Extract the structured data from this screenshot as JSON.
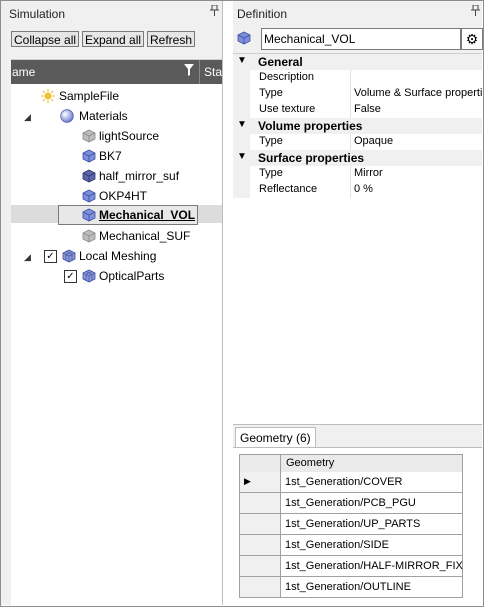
{
  "simulation_panel": {
    "title": "Simulation",
    "pin_glyph": "↑",
    "toolbar": {
      "collapse_all": "Collapse all",
      "expand_all": "Expand all",
      "refresh": "Refresh"
    },
    "tree_header": {
      "name_col": "ame",
      "status_col": "Sta"
    },
    "tree": [
      {
        "label": "SampleFile",
        "icon": "sun-icon"
      },
      {
        "label": "Materials",
        "icon": "sphere-icon",
        "expanded": true
      },
      {
        "label": "lightSource",
        "icon": "cube-gray-icon"
      },
      {
        "label": "BK7",
        "icon": "cube-blue-icon"
      },
      {
        "label": "half_mirror_suf",
        "icon": "cube-dark-icon"
      },
      {
        "label": "OKP4HT",
        "icon": "cube-blue-icon"
      },
      {
        "label": "Mechanical_VOL",
        "icon": "cube-blue-icon",
        "selected": true
      },
      {
        "label": "Mechanical_SUF",
        "icon": "cube-gray-icon"
      },
      {
        "label": "Local Meshing",
        "icon": "mesh-icon",
        "checked": true,
        "expanded": true
      },
      {
        "label": "OpticalParts",
        "icon": "mesh-icon",
        "checked": true
      }
    ]
  },
  "definition_panel": {
    "title": "Definition",
    "pin_glyph": "↑",
    "name_value": "Mechanical_VOL",
    "categories": [
      {
        "label": "General",
        "rows": [
          {
            "name": "Description",
            "value": ""
          },
          {
            "name": "Type",
            "value": "Volume & Surface properties"
          },
          {
            "name": "Use texture",
            "value": "False"
          }
        ]
      },
      {
        "label": "Volume properties",
        "rows": [
          {
            "name": "Type",
            "value": "Opaque"
          }
        ]
      },
      {
        "label": "Surface properties",
        "rows": [
          {
            "name": "Type",
            "value": "Mirror"
          },
          {
            "name": "Reflectance",
            "value": "0 %"
          }
        ]
      }
    ],
    "geometry_tab": "Geometry (6)",
    "geometry_header": "Geometry",
    "geometry_rows": [
      "1st_Generation/COVER",
      "1st_Generation/PCB_PGU",
      "1st_Generation/UP_PARTS",
      "1st_Generation/SIDE",
      "1st_Generation/HALF-MIRROR_FIX",
      "1st_Generation/OUTLINE"
    ]
  },
  "colors": {
    "tree_header_bg": "#5a5a5a",
    "panel_bg": "#f0f0f0",
    "cube_blue": "#5b6fc7",
    "cube_gray": "#a8a8a8"
  }
}
